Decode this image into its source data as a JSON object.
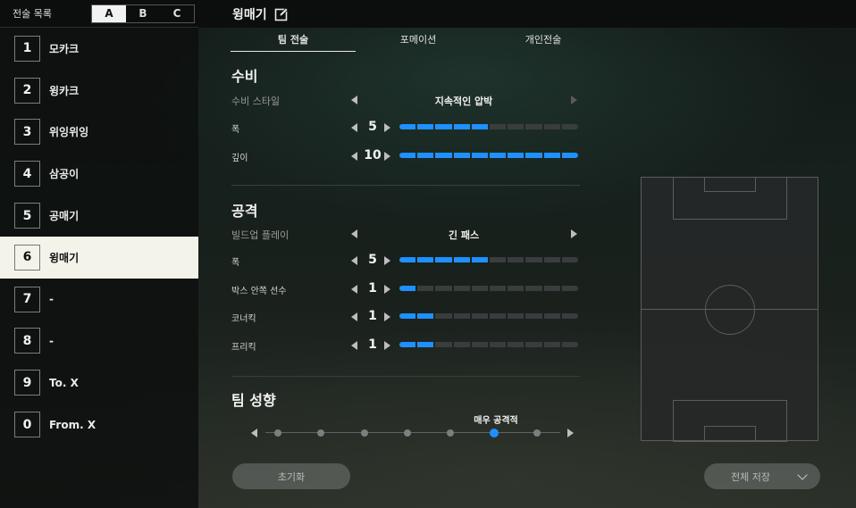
{
  "sidebar": {
    "title": "전술 목록",
    "sets": [
      "A",
      "B",
      "C"
    ],
    "active_set": "A",
    "presets": [
      {
        "num": "1",
        "name": "모카크"
      },
      {
        "num": "2",
        "name": "윙카크"
      },
      {
        "num": "3",
        "name": "위잉위잉"
      },
      {
        "num": "4",
        "name": "삼공이"
      },
      {
        "num": "5",
        "name": "공매기"
      },
      {
        "num": "6",
        "name": "윙매기"
      },
      {
        "num": "7",
        "name": "-"
      },
      {
        "num": "8",
        "name": "-"
      },
      {
        "num": "9",
        "name": "To. X"
      },
      {
        "num": "0",
        "name": "From. X"
      }
    ],
    "active_preset": "6"
  },
  "header": {
    "title": "윙매기",
    "edit_icon": "pencil-edit-icon"
  },
  "tabs": [
    "팀 전술",
    "포메이션",
    "개인전술"
  ],
  "active_tab": "팀 전술",
  "defense": {
    "title": "수비",
    "style_label": "수비 스타일",
    "style_value": "지속적인 압박",
    "width_label": "폭",
    "width_value": "5",
    "depth_label": "깊이",
    "depth_value": "10"
  },
  "attack": {
    "title": "공격",
    "buildup_label": "빌드업 플레이",
    "buildup_value": "긴 패스",
    "width_label": "폭",
    "width_value": "5",
    "box_label": "박스 안쪽 선수",
    "box_value": "1",
    "corner_label": "코너킥",
    "corner_value": "1",
    "freekick_label": "프리킥",
    "freekick_value": "1"
  },
  "tendency": {
    "title": "팀 성향",
    "value": "매우 공격적",
    "steps": 7,
    "selected_step": 6
  },
  "buttons": {
    "reset": "초기화",
    "save_all": "전체 저장"
  },
  "colors": {
    "accent": "#1e90ff",
    "active_preset_bg": "#f4f3ea"
  },
  "bar_max_segments": 10
}
